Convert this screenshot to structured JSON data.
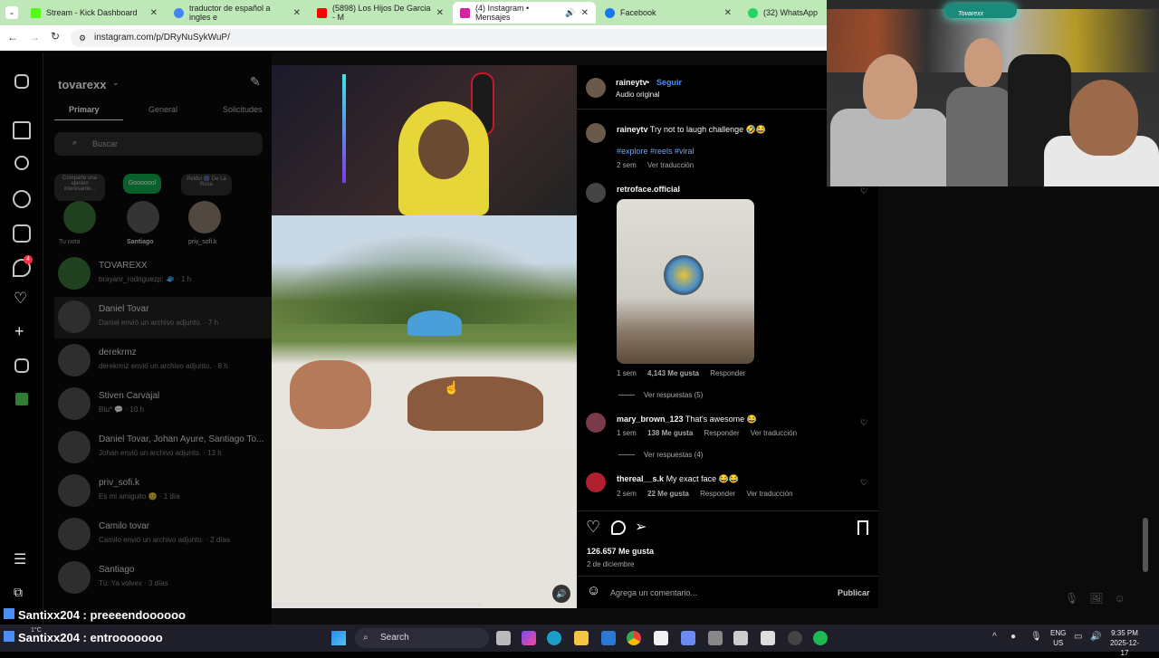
{
  "browser": {
    "tabs": [
      {
        "label": "Stream - Kick Dashboard",
        "color": "#53fc18"
      },
      {
        "label": "traductor de español a ingles e",
        "color": "#4285f4"
      },
      {
        "label": "(5898) Los Hijos De Garcia - M",
        "color": "#ff0000"
      },
      {
        "label": "(4) Instagram • Mensajes",
        "color": "#d6249f"
      },
      {
        "label": "Facebook",
        "color": "#1877f2"
      },
      {
        "label": "(32) WhatsApp",
        "color": "#25d366"
      }
    ],
    "url": "instagram.com/p/DRyNuSykWuP/"
  },
  "inbox": {
    "username": "tovarexx",
    "tabs": [
      "Primary",
      "General",
      "Solicitudes"
    ],
    "search_placeholder": "Buscar",
    "notes": [
      {
        "bubble": "Comparte una opinión interesante...",
        "label": "Tu nota"
      },
      {
        "bubble": "Gooooool",
        "label": "Santiago"
      },
      {
        "bubble": "Peldio 🎆 De La Rose",
        "label": "priv_sofi.k"
      }
    ],
    "threads": [
      {
        "name": "TOVAREXX",
        "preview": "brayanr_rodriguezp: 🧢 · 1 h"
      },
      {
        "name": "Daniel Tovar",
        "preview": "Daniel envió un archivo adjunto. · 7 h"
      },
      {
        "name": "derekrmz",
        "preview": "derekrmz envió un archivo adjunto. · 8 h"
      },
      {
        "name": "Stiven Carvajal",
        "preview": "Btu* 💬 · 10 h"
      },
      {
        "name": "Daniel Tovar, Johan Ayure, Santiago To...",
        "preview": "Johan envió un archivo adjunto. · 13 h"
      },
      {
        "name": "priv_sofi.k",
        "preview": "Es mi amiguito 😊 · 1 día"
      },
      {
        "name": "Camilo tovar",
        "preview": "Camilo envió un archivo adjunto. · 2 días"
      },
      {
        "name": "Santiago",
        "preview": "Tú: Ya volvex · 3 días"
      }
    ]
  },
  "post": {
    "author": "raineytv",
    "follow": "Seguir",
    "audio": "Audio original",
    "caption_user": "raineytv",
    "caption": "Try not to laugh challenge 🤣😂",
    "hashtags": "#explore #reels #viral",
    "caption_time": "2 sem",
    "caption_translate": "Ver traducción",
    "comments": [
      {
        "user": "retroface.official",
        "text": "",
        "time": "1 sem",
        "likes": "4,143 Me gusta",
        "reply": "Responder",
        "translate": "",
        "replies": "Ver respuestas (5)"
      },
      {
        "user": "mary_brown_123",
        "text": "That's awesome 😂",
        "time": "1 sem",
        "likes": "138 Me gusta",
        "reply": "Responder",
        "translate": "Ver traducción",
        "replies": "Ver respuestas (4)"
      },
      {
        "user": "thereal__s.k",
        "text": "My exact face 😂😂",
        "time": "2 sem",
        "likes": "22 Me gusta",
        "reply": "Responder",
        "translate": "Ver traducción",
        "replies": ""
      }
    ],
    "likes_total": "126.657 Me gusta",
    "date": "2 de diciembre",
    "comment_placeholder": "Agrega un comentario...",
    "publish": "Publicar"
  },
  "webcam": {
    "sign": "Tovarexx"
  },
  "chat": [
    {
      "user": "Santixx204",
      "msg": "preeeendoooooo"
    },
    {
      "user": "Santixx204",
      "msg": "entrooooooo"
    }
  ],
  "taskbar": {
    "search": "Search",
    "lang_top": "ENG",
    "lang_bottom": "US",
    "time": "9:35 PM",
    "date": "2025-12-17",
    "weather": "1°C"
  }
}
